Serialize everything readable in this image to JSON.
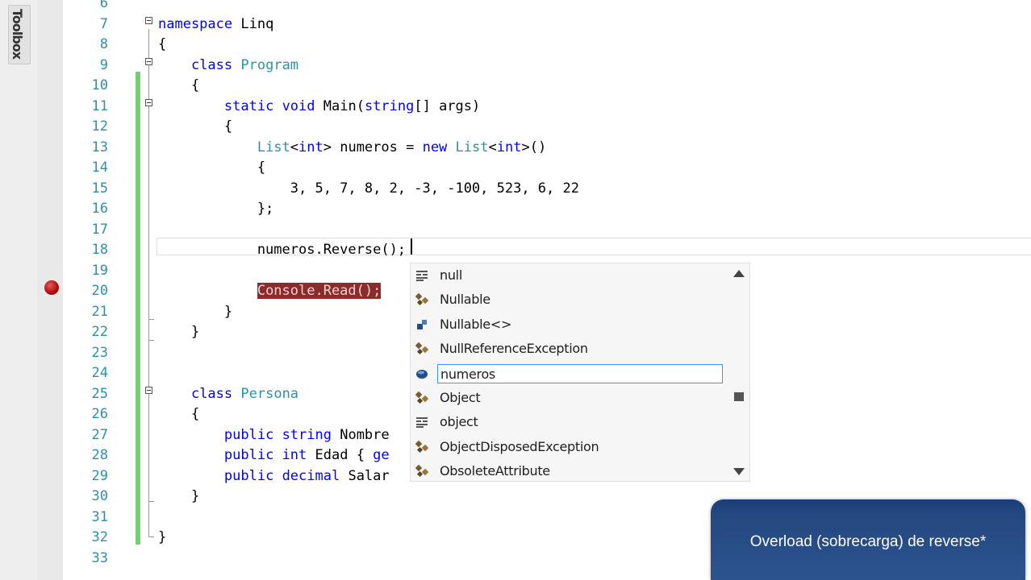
{
  "toolbox": {
    "label": "Toolbox"
  },
  "editor": {
    "lines": [
      {
        "n": "6",
        "html": ""
      },
      {
        "n": "7",
        "html": "<span class=\"kw\">namespace</span> Linq"
      },
      {
        "n": "8",
        "html": "{"
      },
      {
        "n": "9",
        "html": "    <span class=\"kw\">class</span> <span class=\"ty\">Program</span>"
      },
      {
        "n": "10",
        "html": "    {"
      },
      {
        "n": "11",
        "html": "        <span class=\"kw\">static</span> <span class=\"kw\">void</span> Main(<span class=\"kw\">string</span>[] args)"
      },
      {
        "n": "12",
        "html": "        {"
      },
      {
        "n": "13",
        "html": "            <span class=\"ty\">List</span>&lt;<span class=\"kw\">int</span>&gt; numeros = <span class=\"kw\">new</span> <span class=\"ty\">List</span>&lt;<span class=\"kw\">int</span>&gt;()"
      },
      {
        "n": "14",
        "html": "            {"
      },
      {
        "n": "15",
        "html": "                3, 5, 7, 8, 2, -3, -100, 523, 6, 22"
      },
      {
        "n": "16",
        "html": "            };"
      },
      {
        "n": "17",
        "html": ""
      },
      {
        "n": "18",
        "html": "            numeros.Reverse();"
      },
      {
        "n": "19",
        "html": ""
      },
      {
        "n": "20",
        "html": "            <span class=\"hl\">Console.Read();</span>"
      },
      {
        "n": "21",
        "html": "        }"
      },
      {
        "n": "22",
        "html": "    }"
      },
      {
        "n": "23",
        "html": ""
      },
      {
        "n": "24",
        "html": ""
      },
      {
        "n": "25",
        "html": "    <span class=\"kw\">class</span> <span class=\"ty\">Persona</span>"
      },
      {
        "n": "26",
        "html": "    {"
      },
      {
        "n": "27",
        "html": "        <span class=\"kw\">public</span> <span class=\"kw\">string</span> Nombre"
      },
      {
        "n": "28",
        "html": "        <span class=\"kw\">public</span> <span class=\"kw\">int</span> Edad { <span class=\"kw\">ge</span>"
      },
      {
        "n": "29",
        "html": "        <span class=\"kw\">public</span> <span class=\"kw\">decimal</span> Salar"
      },
      {
        "n": "30",
        "html": "    }"
      },
      {
        "n": "31",
        "html": ""
      },
      {
        "n": "32",
        "html": "}"
      },
      {
        "n": "33",
        "html": ""
      }
    ]
  },
  "intellisense": {
    "items": [
      {
        "label": "null",
        "icon": "keyword-icon"
      },
      {
        "label": "Nullable",
        "icon": "struct-icon"
      },
      {
        "label": "Nullable<>",
        "icon": "generic-type-icon"
      },
      {
        "label": "NullReferenceException",
        "icon": "class-icon"
      },
      {
        "label": "numeros",
        "icon": "local-variable-icon",
        "selected": true
      },
      {
        "label": "Object",
        "icon": "class-icon"
      },
      {
        "label": "object",
        "icon": "keyword-icon"
      },
      {
        "label": "ObjectDisposedException",
        "icon": "class-icon"
      },
      {
        "label": "ObsoleteAttribute",
        "icon": "class-icon"
      }
    ]
  },
  "tip": {
    "text": "Overload (sobrecarga) de reverse*"
  }
}
